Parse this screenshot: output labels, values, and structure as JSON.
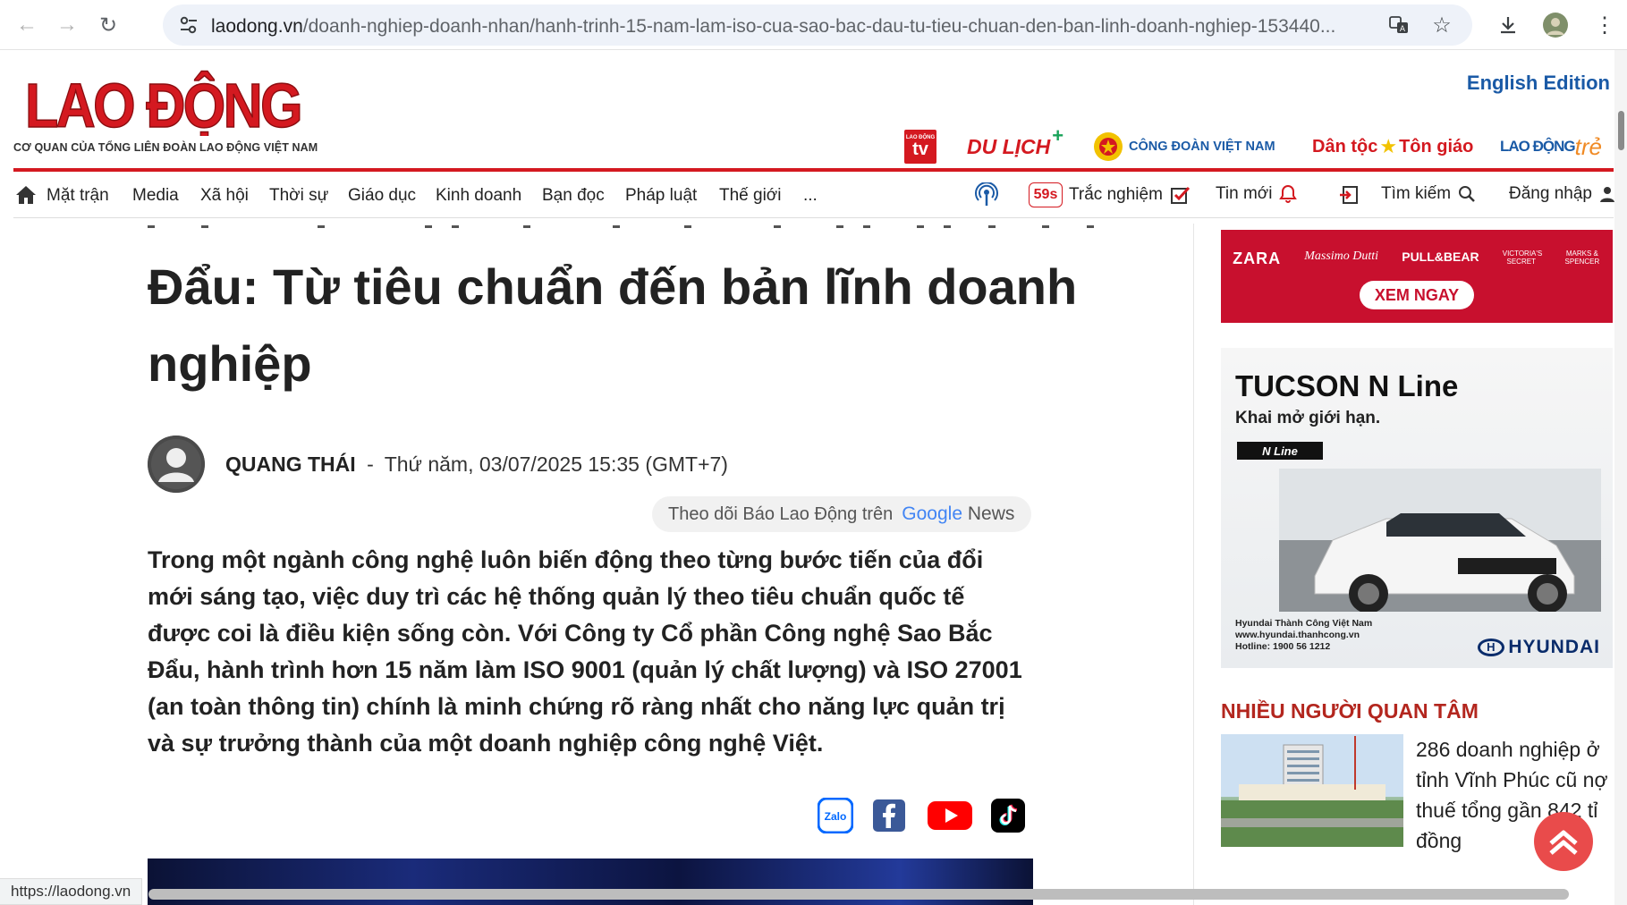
{
  "browser": {
    "url_host": "laodong.vn",
    "url_path": "/doanh-nghiep-doanh-nhan/hanh-trinh-15-nam-lam-iso-cua-sao-bac-dau-tu-tieu-chuan-den-ban-linh-doanh-nghiep-153440...",
    "status_url": "https://laodong.vn"
  },
  "header": {
    "logo_text": "LAO ĐỘNG",
    "logo_subtitle": "CƠ QUAN CỦA TỔNG LIÊN ĐOÀN LAO ĐỘNG VIỆT NAM",
    "english_edition": "English Edition",
    "partners": {
      "tv_top": "LAO ĐỘNG",
      "tv": "tv",
      "dulich": "DU LỊCH",
      "congdoan": "CÔNG ĐOÀN VIỆT NAM",
      "dantoc": "Dân tộc",
      "tongiao": "Tôn giáo",
      "laodongtre_1": "LAO ĐỘNG",
      "laodongtre_2": "trẻ"
    }
  },
  "menu": {
    "items": [
      "Mặt trận",
      "Media",
      "Xã hội",
      "Thời sự",
      "Giáo dục",
      "Kinh doanh",
      "Bạn đọc",
      "Pháp luật",
      "Thế giới",
      "..."
    ],
    "badge": "59s",
    "quiz": "Trắc nghiệm",
    "latest": "Tin mới",
    "search": "Tìm kiếm",
    "login": "Đăng nhập"
  },
  "article": {
    "title": "Đẩu: Từ tiêu chuẩn đến bản lĩnh doanh nghiệp",
    "author": "QUANG THÁI",
    "separator": "-",
    "date": "Thứ năm, 03/07/2025 15:35 (GMT+7)",
    "follow_text": "Theo dõi Báo Lao Động trên",
    "google": "Google",
    "news": "News",
    "sapo": "Trong một ngành công nghệ luôn biến động theo từng bước tiến của đổi mới sáng tạo, việc duy trì các hệ thống quản lý theo tiêu chuẩn quốc tế được coi là điều kiện sống còn. Với Công ty Cổ phần Công nghệ Sao Bắc Đẩu, hành trình hơn 15 năm làm ISO 9001 (quản lý chất lượng) và ISO 27001 (an toàn thông tin) chính là minh chứng rõ ràng nhất cho năng lực quản trị và sự trưởng thành của một doanh nghiệp công nghệ Việt.",
    "share": {
      "zalo": "Zalo"
    }
  },
  "sidebar": {
    "ad1": {
      "brands": [
        "ZARA",
        "Massimo Dutti",
        "PULL&BEAR",
        "VICTORIA'S SECRET",
        "MARKS & SPENCER"
      ],
      "cta": "XEM NGAY"
    },
    "ad2": {
      "headline": "TUCSON N Line",
      "tagline": "Khai mở giới hạn.",
      "nline": "N Line",
      "fine_1": "Hyundai Thành Công Việt Nam",
      "fine_2": "www.hyundai.thanhcong.vn",
      "fine_3": "Hotline: 1900 56 1212",
      "brand": "HYUNDAI"
    },
    "most_read_heading": "NHIỀU NGƯỜI QUAN TÂM",
    "most_read_title": "286 doanh nghiệp ở tỉnh Vĩnh Phúc cũ nợ thuế tổng gần 842 tỉ đồng"
  },
  "colors": {
    "brand_red": "#d41920",
    "english_blue": "#1a5aa6",
    "heading_red": "#b3261e"
  }
}
